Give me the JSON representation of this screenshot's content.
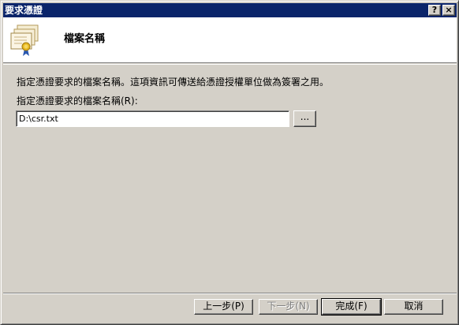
{
  "window": {
    "title": "要求憑證",
    "help_label": "?",
    "close_label": "×"
  },
  "header": {
    "title": "檔案名稱",
    "icon": "certificate-icon"
  },
  "content": {
    "description": "指定憑證要求的檔案名稱。這項資訊可傳送給憑證授權單位做為簽署之用。",
    "field_label": "指定憑證要求的檔案名稱(R):",
    "filename_value": "D:\\csr.txt",
    "browse_label": "..."
  },
  "footer": {
    "back_label": "上一步(P)",
    "next_label": "下一步(N)",
    "finish_label": "完成(F)",
    "cancel_label": "取消"
  },
  "colors": {
    "titlebar": "#0a246a",
    "face": "#d4d0c8",
    "header_bg": "#ffffff"
  }
}
